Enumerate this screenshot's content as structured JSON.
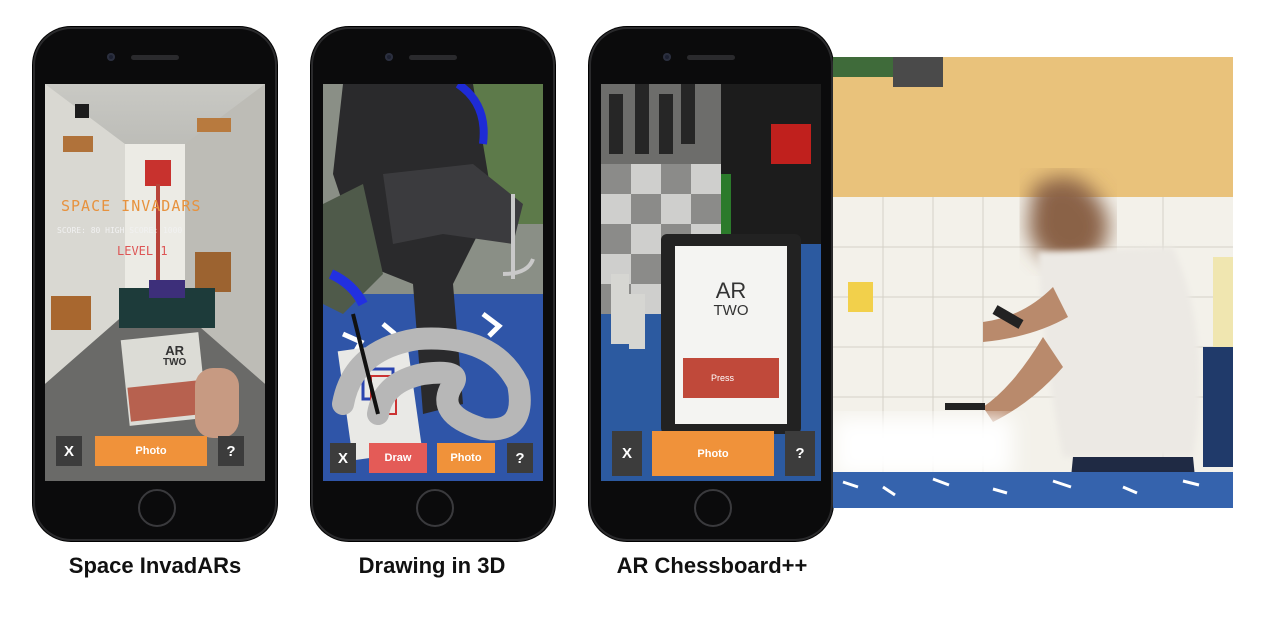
{
  "panels": [
    {
      "caption": "Space InvadARs",
      "hud": {
        "title": "SPACE INVADARS",
        "score_line": "SCORE: 80  HIGH SCORE: 1000",
        "level": "LEVEL 1"
      },
      "card": {
        "line1": "AR",
        "line2": "TWO"
      },
      "buttons": {
        "close": "X",
        "photo": "Photo",
        "help": "?"
      }
    },
    {
      "caption": "Drawing in 3D",
      "buttons": {
        "close": "X",
        "draw": "Draw",
        "photo": "Photo",
        "help": "?"
      }
    },
    {
      "caption": "AR Chessboard++",
      "card": {
        "line1": "AR",
        "line2": "TWO",
        "press": "Press"
      },
      "buttons": {
        "close": "X",
        "photo": "Photo",
        "help": "?"
      }
    }
  ],
  "colors": {
    "accent_orange": "#f0923a",
    "draw_red": "#e45b57",
    "button_dark": "#3c3c3c"
  }
}
